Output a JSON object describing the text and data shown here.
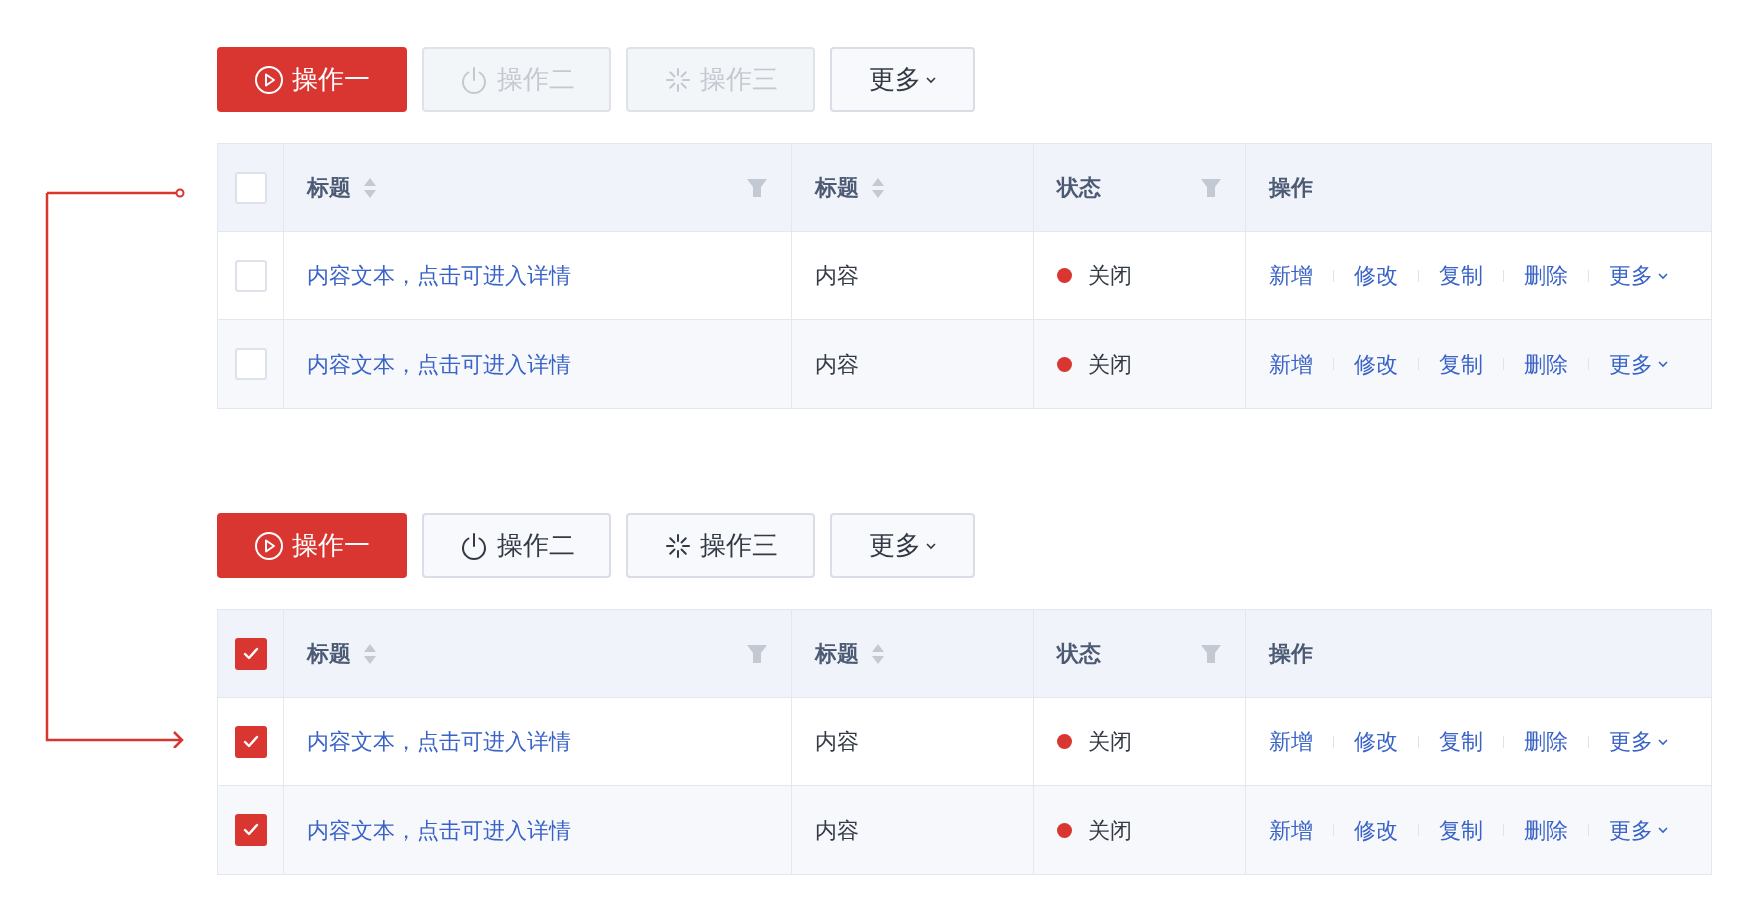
{
  "groups": [
    {
      "buttons": [
        {
          "label": "操作一",
          "kind": "play",
          "primary": true,
          "disabled": false
        },
        {
          "label": "操作二",
          "kind": "power",
          "primary": false,
          "disabled": true
        },
        {
          "label": "操作三",
          "kind": "loading",
          "primary": false,
          "disabled": true
        },
        {
          "label": "更多",
          "kind": "more",
          "primary": false,
          "disabled": false
        }
      ],
      "table": {
        "select_all_checked": false,
        "columns": [
          {
            "kind": "select"
          },
          {
            "label": "标题",
            "kind": "sort-filter"
          },
          {
            "label": "标题",
            "kind": "sort"
          },
          {
            "label": "状态",
            "kind": "filter"
          },
          {
            "label": "操作",
            "kind": "plain"
          }
        ],
        "rows": [
          {
            "checked": false,
            "title": "内容文本，点击可进入详情",
            "content": "内容",
            "status": {
              "label": "关闭",
              "color": "#d93632"
            },
            "actions": [
              "新增",
              "修改",
              "复制",
              "删除",
              "更多"
            ]
          },
          {
            "checked": false,
            "title": "内容文本，点击可进入详情",
            "content": "内容",
            "status": {
              "label": "关闭",
              "color": "#d93632"
            },
            "actions": [
              "新增",
              "修改",
              "复制",
              "删除",
              "更多"
            ]
          }
        ]
      }
    },
    {
      "buttons": [
        {
          "label": "操作一",
          "kind": "play",
          "primary": true,
          "disabled": false
        },
        {
          "label": "操作二",
          "kind": "power",
          "primary": false,
          "disabled": false
        },
        {
          "label": "操作三",
          "kind": "loading",
          "primary": false,
          "disabled": false
        },
        {
          "label": "更多",
          "kind": "more",
          "primary": false,
          "disabled": false
        }
      ],
      "table": {
        "select_all_checked": true,
        "columns": [
          {
            "kind": "select"
          },
          {
            "label": "标题",
            "kind": "sort-filter"
          },
          {
            "label": "标题",
            "kind": "sort"
          },
          {
            "label": "状态",
            "kind": "filter"
          },
          {
            "label": "操作",
            "kind": "plain"
          }
        ],
        "rows": [
          {
            "checked": true,
            "title": "内容文本，点击可进入详情",
            "content": "内容",
            "status": {
              "label": "关闭",
              "color": "#d93632"
            },
            "actions": [
              "新增",
              "修改",
              "复制",
              "删除",
              "更多"
            ]
          },
          {
            "checked": true,
            "title": "内容文本，点击可进入详情",
            "content": "内容",
            "status": {
              "label": "关闭",
              "color": "#d93632"
            },
            "actions": [
              "新增",
              "修改",
              "复制",
              "删除",
              "更多"
            ]
          }
        ]
      }
    }
  ]
}
